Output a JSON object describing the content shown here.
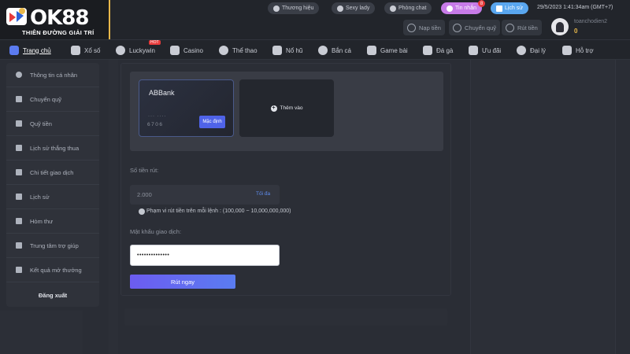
{
  "brand": {
    "logo_text": "OK88",
    "tagline": "THIÊN ĐƯỜNG GIẢI TRÍ",
    "accent": "#e8b84a"
  },
  "header": {
    "pills": [
      {
        "label": "Thương hiệu",
        "icon": "home-icon"
      },
      {
        "label": "Sexy lady",
        "icon": "play-icon"
      },
      {
        "label": "Phòng chat",
        "icon": "chat-icon"
      },
      {
        "label": "Tin nhắn",
        "icon": "mail-icon",
        "badge": "8"
      },
      {
        "label": "Lịch sử",
        "icon": "history-icon"
      }
    ],
    "clock": "29/5/2023 1:41:34am  (GMT+7)",
    "actions": [
      {
        "label": "Nạp tiền",
        "icon": "deposit-icon"
      },
      {
        "label": "Chuyển quỹ",
        "icon": "transfer-icon"
      },
      {
        "label": "Rút tiền",
        "icon": "withdraw-icon"
      }
    ],
    "username": "toanchodien2",
    "balance": "0"
  },
  "nav": {
    "items": [
      {
        "label": "Trang chủ",
        "icon": "home-icon"
      },
      {
        "label": "Xổ số",
        "icon": "lottery-icon"
      },
      {
        "label": "Luckywin",
        "icon": "ball-icon",
        "tag": "HOT"
      },
      {
        "label": "Casino",
        "icon": "casino-icon"
      },
      {
        "label": "Thể thao",
        "icon": "soccer-icon"
      },
      {
        "label": "Nổ hũ",
        "icon": "slot-icon"
      },
      {
        "label": "Bắn cá",
        "icon": "fish-icon"
      },
      {
        "label": "Game bài",
        "icon": "cards-icon"
      },
      {
        "label": "Đá gà",
        "icon": "rooster-icon"
      },
      {
        "label": "Ưu đãi",
        "icon": "gift-icon"
      },
      {
        "label": "Đại lý",
        "icon": "agent-icon"
      },
      {
        "label": "Hỗ trợ",
        "icon": "support-icon"
      }
    ]
  },
  "sidebar": {
    "items": [
      {
        "label": "Thông tin cá nhân",
        "icon": "user-icon"
      },
      {
        "label": "Chuyển quỹ",
        "icon": "wallet-icon"
      },
      {
        "label": "Quỹ tiền",
        "icon": "fund-icon"
      },
      {
        "label": "Lịch sử thắng thua",
        "icon": "history-icon"
      },
      {
        "label": "Chi tiết giao dịch",
        "icon": "list-icon"
      },
      {
        "label": "Lịch sử",
        "icon": "history-icon"
      },
      {
        "label": "Hòm thư",
        "icon": "mail-icon"
      },
      {
        "label": "Trung tâm trợ giúp",
        "icon": "help-icon"
      },
      {
        "label": "Kết quả mở thưởng",
        "icon": "trophy-icon"
      }
    ],
    "logout": "Đăng xuất"
  },
  "withdraw": {
    "card": {
      "bank": "ABBank",
      "masked": "···  ····",
      "last_digits": "6706",
      "default_label": "Mặc định"
    },
    "add_card": "Thêm vào",
    "amount_label": "Số tiền rút:",
    "amount_value": "2.000",
    "max_label": "Tối đa",
    "range_note": "Phạm vi rút tiền trên mỗi lệnh : (100,000 ~ 10,000,000,000)",
    "password_label": "Mật khẩu giao dịch:",
    "password_value": "••••••••••••••",
    "submit": "Rút ngay"
  }
}
